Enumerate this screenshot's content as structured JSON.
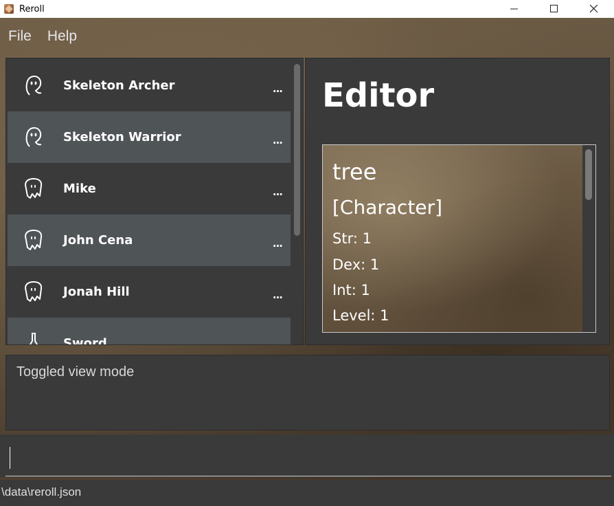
{
  "window": {
    "title": "Reroll",
    "minimize": "—",
    "maximize": "☐",
    "close": "✕"
  },
  "menu": {
    "file": "File",
    "help": "Help"
  },
  "list": {
    "items": [
      {
        "name": "Skeleton Archer",
        "more": "...",
        "icon": "ghost-icon"
      },
      {
        "name": "Skeleton Warrior",
        "more": "...",
        "icon": "ghost-icon"
      },
      {
        "name": "Mike",
        "more": "...",
        "icon": "monster-icon"
      },
      {
        "name": "John Cena",
        "more": "...",
        "icon": "monster-icon"
      },
      {
        "name": "Jonah Hill",
        "more": "...",
        "icon": "monster-icon"
      },
      {
        "name": "Sword",
        "more": "",
        "icon": "potion-icon"
      }
    ]
  },
  "editor": {
    "title": "Editor",
    "card": {
      "name": "tree",
      "type": "[Character]",
      "stats": [
        "Str: 1",
        "Dex: 1",
        "Int: 1",
        "Level: 1"
      ]
    }
  },
  "result": {
    "text": "Toggled view mode"
  },
  "command": {
    "value": ""
  },
  "status": {
    "path": "\\data\\reroll.json"
  }
}
